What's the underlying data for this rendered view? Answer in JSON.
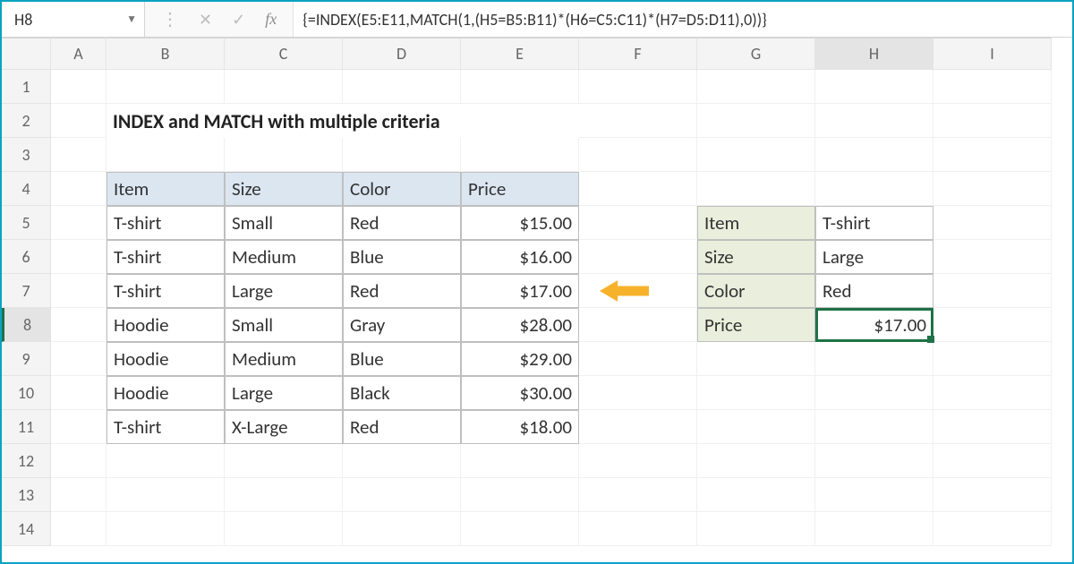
{
  "name_box": "H8",
  "formula": "{=INDEX(E5:E11,MATCH(1,(H5=B5:B11)*(H6=C5:C11)*(H7=D5:D11),0))}",
  "columns": [
    "",
    "A",
    "B",
    "C",
    "D",
    "E",
    "F",
    "G",
    "H",
    "I"
  ],
  "row_nums": [
    "1",
    "2",
    "3",
    "4",
    "5",
    "6",
    "7",
    "8",
    "9",
    "10",
    "11",
    "12",
    "13",
    "14"
  ],
  "title": "INDEX and MATCH with multiple criteria",
  "table": {
    "headers": [
      "Item",
      "Size",
      "Color",
      "Price"
    ],
    "rows": [
      [
        "T-shirt",
        "Small",
        "Red",
        "$15.00"
      ],
      [
        "T-shirt",
        "Medium",
        "Blue",
        "$16.00"
      ],
      [
        "T-shirt",
        "Large",
        "Red",
        "$17.00"
      ],
      [
        "Hoodie",
        "Small",
        "Gray",
        "$28.00"
      ],
      [
        "Hoodie",
        "Medium",
        "Blue",
        "$29.00"
      ],
      [
        "Hoodie",
        "Large",
        "Black",
        "$30.00"
      ],
      [
        "T-shirt",
        "X-Large",
        "Red",
        "$18.00"
      ]
    ]
  },
  "lookup": {
    "labels": [
      "Item",
      "Size",
      "Color",
      "Price"
    ],
    "values": [
      "T-shirt",
      "Large",
      "Red",
      "$17.00"
    ]
  },
  "icons": {
    "cancel": "✕",
    "enter": "✓",
    "fx": "fx",
    "dots": "⋮",
    "dd": "▼"
  },
  "selected_cell": "H8",
  "highlight_row_index": 2
}
